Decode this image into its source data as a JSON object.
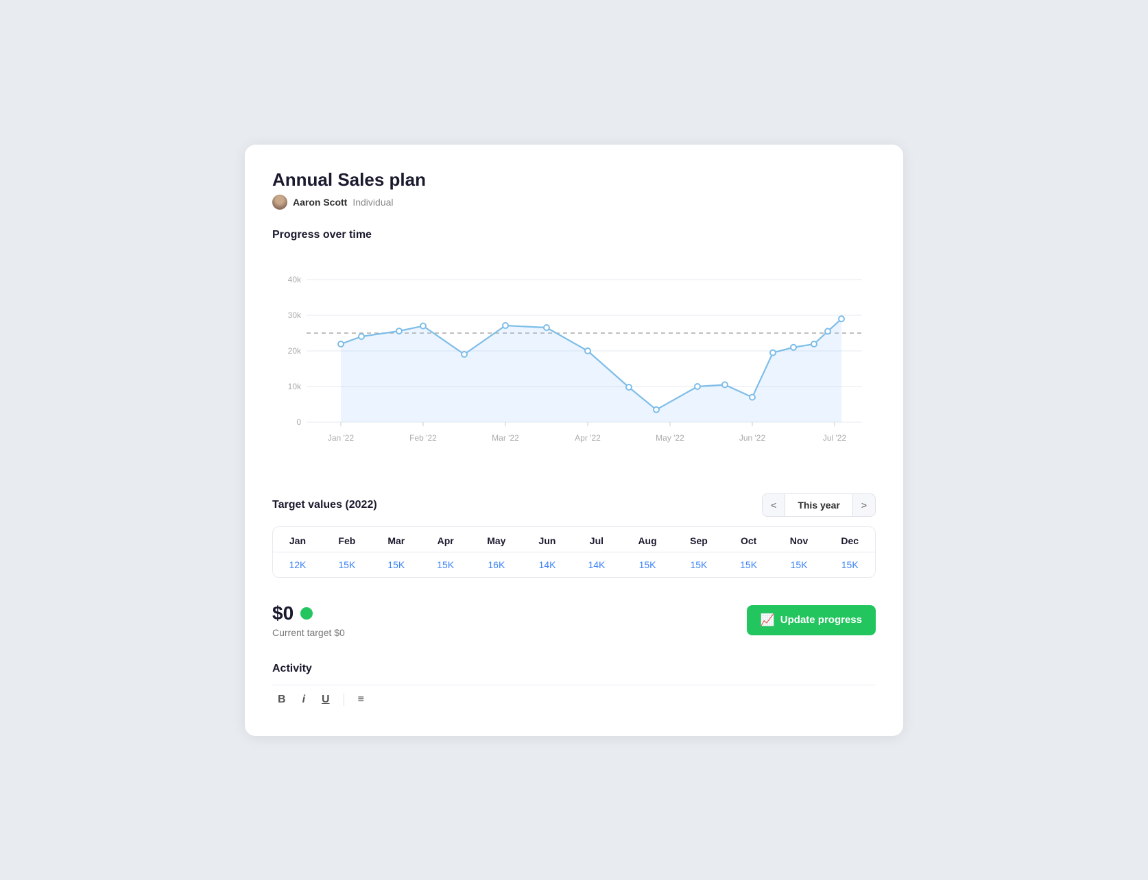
{
  "title": "Annual Sales plan",
  "user": {
    "name": "Aaron Scott",
    "type": "Individual"
  },
  "chart": {
    "section_title": "Progress over time",
    "y_labels": [
      "40k",
      "30k",
      "20k",
      "10k",
      "0"
    ],
    "x_labels": [
      "Jan '22",
      "Feb '22",
      "Mar '22",
      "Apr '22",
      "May '22",
      "Jun '22",
      "Jul '22"
    ],
    "data_points": [
      22000,
      24000,
      25500,
      27000,
      19000,
      27000,
      26500,
      20000,
      9800,
      3500,
      10000,
      10500,
      7000,
      19500,
      21000,
      22000,
      25500,
      29000
    ]
  },
  "target": {
    "title": "Target values (2022)",
    "year_nav": {
      "label": "This year",
      "prev_label": "<",
      "next_label": ">"
    },
    "columns": [
      "Jan",
      "Feb",
      "Mar",
      "Apr",
      "May",
      "Jun",
      "Jul",
      "Aug",
      "Sep",
      "Oct",
      "Nov",
      "Dec"
    ],
    "values": [
      "12K",
      "15K",
      "15K",
      "15K",
      "16K",
      "14K",
      "14K",
      "15K",
      "15K",
      "15K",
      "15K",
      "15K"
    ]
  },
  "progress": {
    "amount": "$0",
    "current_target_label": "Current target $0",
    "update_button_label": "Update progress",
    "update_icon": "📈"
  },
  "activity": {
    "title": "Activity",
    "toolbar": {
      "bold": "B",
      "italic": "i",
      "underline": "U",
      "list": "≡"
    }
  }
}
